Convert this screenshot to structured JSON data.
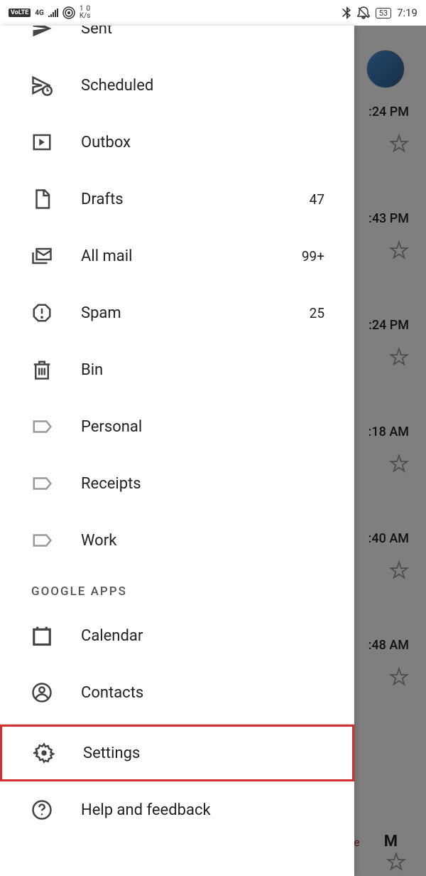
{
  "status": {
    "volte": "VoLTE",
    "network": "4G",
    "speed_top": "1",
    "speed_bottom": "0",
    "speed_unit": "K/s",
    "battery": "53",
    "time": "7:19"
  },
  "drawer": {
    "items": [
      {
        "label": "Sent",
        "count": ""
      },
      {
        "label": "Scheduled",
        "count": ""
      },
      {
        "label": "Outbox",
        "count": ""
      },
      {
        "label": "Drafts",
        "count": "47"
      },
      {
        "label": "All mail",
        "count": "99+"
      },
      {
        "label": "Spam",
        "count": "25"
      },
      {
        "label": "Bin",
        "count": ""
      },
      {
        "label": "Personal",
        "count": ""
      },
      {
        "label": "Receipts",
        "count": ""
      },
      {
        "label": "Work",
        "count": ""
      }
    ],
    "section_google_apps": "GOOGLE APPS",
    "google_apps": [
      {
        "label": "Calendar"
      },
      {
        "label": "Contacts"
      }
    ],
    "footer": [
      {
        "label": "Settings"
      },
      {
        "label": "Help and feedback"
      }
    ]
  },
  "background": {
    "times": [
      ":24 PM",
      ":43 PM",
      ":24 PM",
      ":18 AM",
      ":40 AM",
      ":48 AM"
    ],
    "letter_m": "M",
    "letter_e": "e"
  }
}
